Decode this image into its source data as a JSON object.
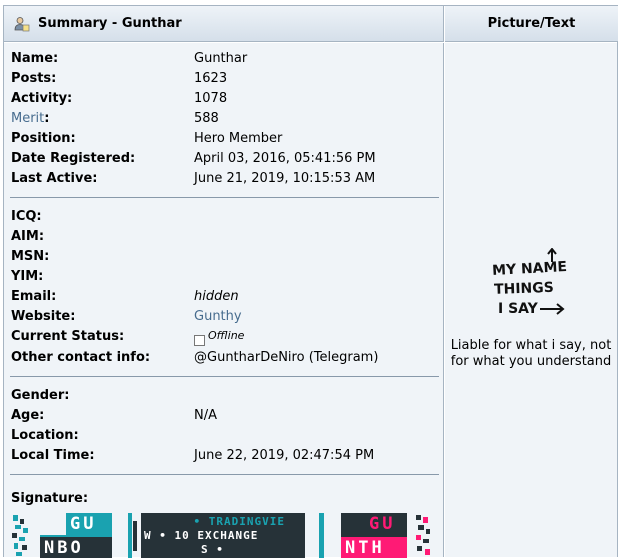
{
  "header": {
    "summary_title": "Summary - Gunthar",
    "picture_title": "Picture/Text"
  },
  "profile": {
    "name_label": "Name:",
    "name": "Gunthar",
    "posts_label": "Posts:",
    "posts": "1623",
    "activity_label": "Activity:",
    "activity": "1078",
    "merit_label": "Merit",
    "merit_colon": ":",
    "merit": "588",
    "position_label": "Position:",
    "position": "Hero Member",
    "registered_label": "Date Registered:",
    "registered": "April 03, 2016, 05:41:56 PM",
    "last_active_label": "Last Active:",
    "last_active": "June 21, 2019, 10:15:53 AM"
  },
  "contact": {
    "icq_label": "ICQ:",
    "aim_label": "AIM:",
    "msn_label": "MSN:",
    "yim_label": "YIM:",
    "email_label": "Email:",
    "email": "hidden",
    "website_label": "Website:",
    "website": "Gunthy",
    "status_label": "Current Status:",
    "status": "Offline",
    "other_label": "Other contact info:",
    "other": "@GuntharDeNiro (Telegram)"
  },
  "personal": {
    "gender_label": "Gender:",
    "age_label": "Age:",
    "age": "N/A",
    "location_label": "Location:",
    "local_time_label": "Local Time:",
    "local_time": "June 22, 2019, 02:47:54 PM"
  },
  "signature": {
    "label": "Signature:",
    "tile1_top": "GU",
    "tile1_bottom": "NBO",
    "tile2_line1": "• TRADINGVIE",
    "tile2_line2": "W • 10 EXCHANGE",
    "tile2_line3": "S •",
    "tile3_top": "GU",
    "tile3_bottom": "NTH"
  },
  "picture": {
    "image_line1": "MY NAME",
    "image_line2": "THINGS",
    "image_line3": "I SAY",
    "personal_text": "Liable for what i say, not for what you understand"
  },
  "colors": {
    "link": "#476c8e",
    "panel_bg": "#f0f4f8",
    "border": "#a6b4c2",
    "sig_teal": "#1aa2b0",
    "sig_dark": "#263238",
    "sig_pink": "#ff1a75"
  }
}
